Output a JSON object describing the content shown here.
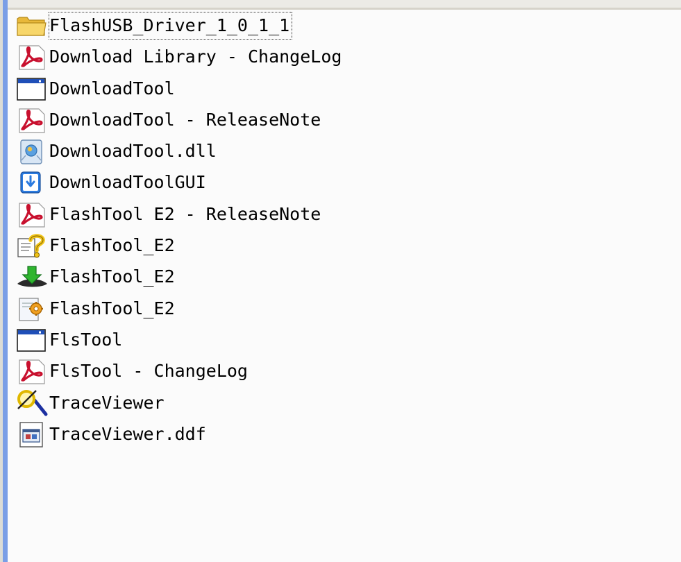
{
  "file_list": {
    "items": [
      {
        "label": "FlashUSB_Driver_1_0_1_1",
        "icon": "folder-icon",
        "selected": true
      },
      {
        "label": "Download Library - ChangeLog",
        "icon": "pdf-icon"
      },
      {
        "label": "DownloadTool",
        "icon": "application-window-icon"
      },
      {
        "label": "DownloadTool - ReleaseNote",
        "icon": "pdf-icon"
      },
      {
        "label": "DownloadTool.dll",
        "icon": "dll-file-icon"
      },
      {
        "label": "DownloadToolGUI",
        "icon": "download-app-icon"
      },
      {
        "label": "FlashTool E2 - ReleaseNote",
        "icon": "pdf-icon"
      },
      {
        "label": "FlashTool_E2",
        "icon": "help-file-icon"
      },
      {
        "label": "FlashTool_E2",
        "icon": "green-arrow-download-icon"
      },
      {
        "label": "FlashTool_E2",
        "icon": "config-settings-icon"
      },
      {
        "label": "FlsTool",
        "icon": "application-window-icon"
      },
      {
        "label": "FlsTool - ChangeLog",
        "icon": "pdf-icon"
      },
      {
        "label": "TraceViewer",
        "icon": "magnifier-app-icon"
      },
      {
        "label": "TraceViewer.ddf",
        "icon": "data-file-icon"
      }
    ]
  },
  "colors": {
    "pdf_red": "#c8102e",
    "folder_yellow": "#f2cf5b",
    "window_blue": "#1f4fb8",
    "sidebar_blue": "#7a9ee6"
  }
}
